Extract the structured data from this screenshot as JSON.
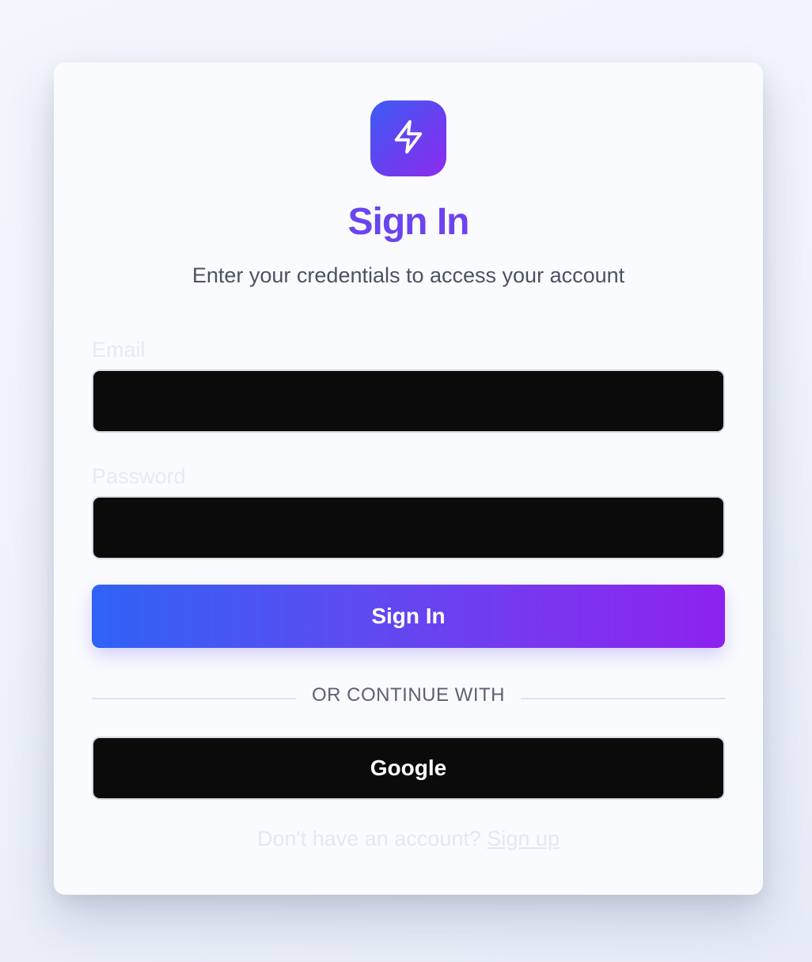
{
  "app": {
    "logo_icon": "lightning-bolt-icon"
  },
  "header": {
    "title": "Sign In",
    "subtitle": "Enter your credentials to access your account"
  },
  "form": {
    "email_label": "Email",
    "email_value": "",
    "password_label": "Password",
    "password_value": "",
    "submit_label": "Sign In"
  },
  "divider": {
    "text": "OR CONTINUE WITH"
  },
  "social": {
    "google_label": "Google"
  },
  "footer": {
    "prompt": "Don't have an account?",
    "signup_link": "Sign up"
  },
  "colors": {
    "accent_start": "#2f62f5",
    "accent_end": "#8d22ee",
    "title": "#6b46ee",
    "input_bg": "#0b0b0c",
    "page_bg": "#eef2fb"
  }
}
